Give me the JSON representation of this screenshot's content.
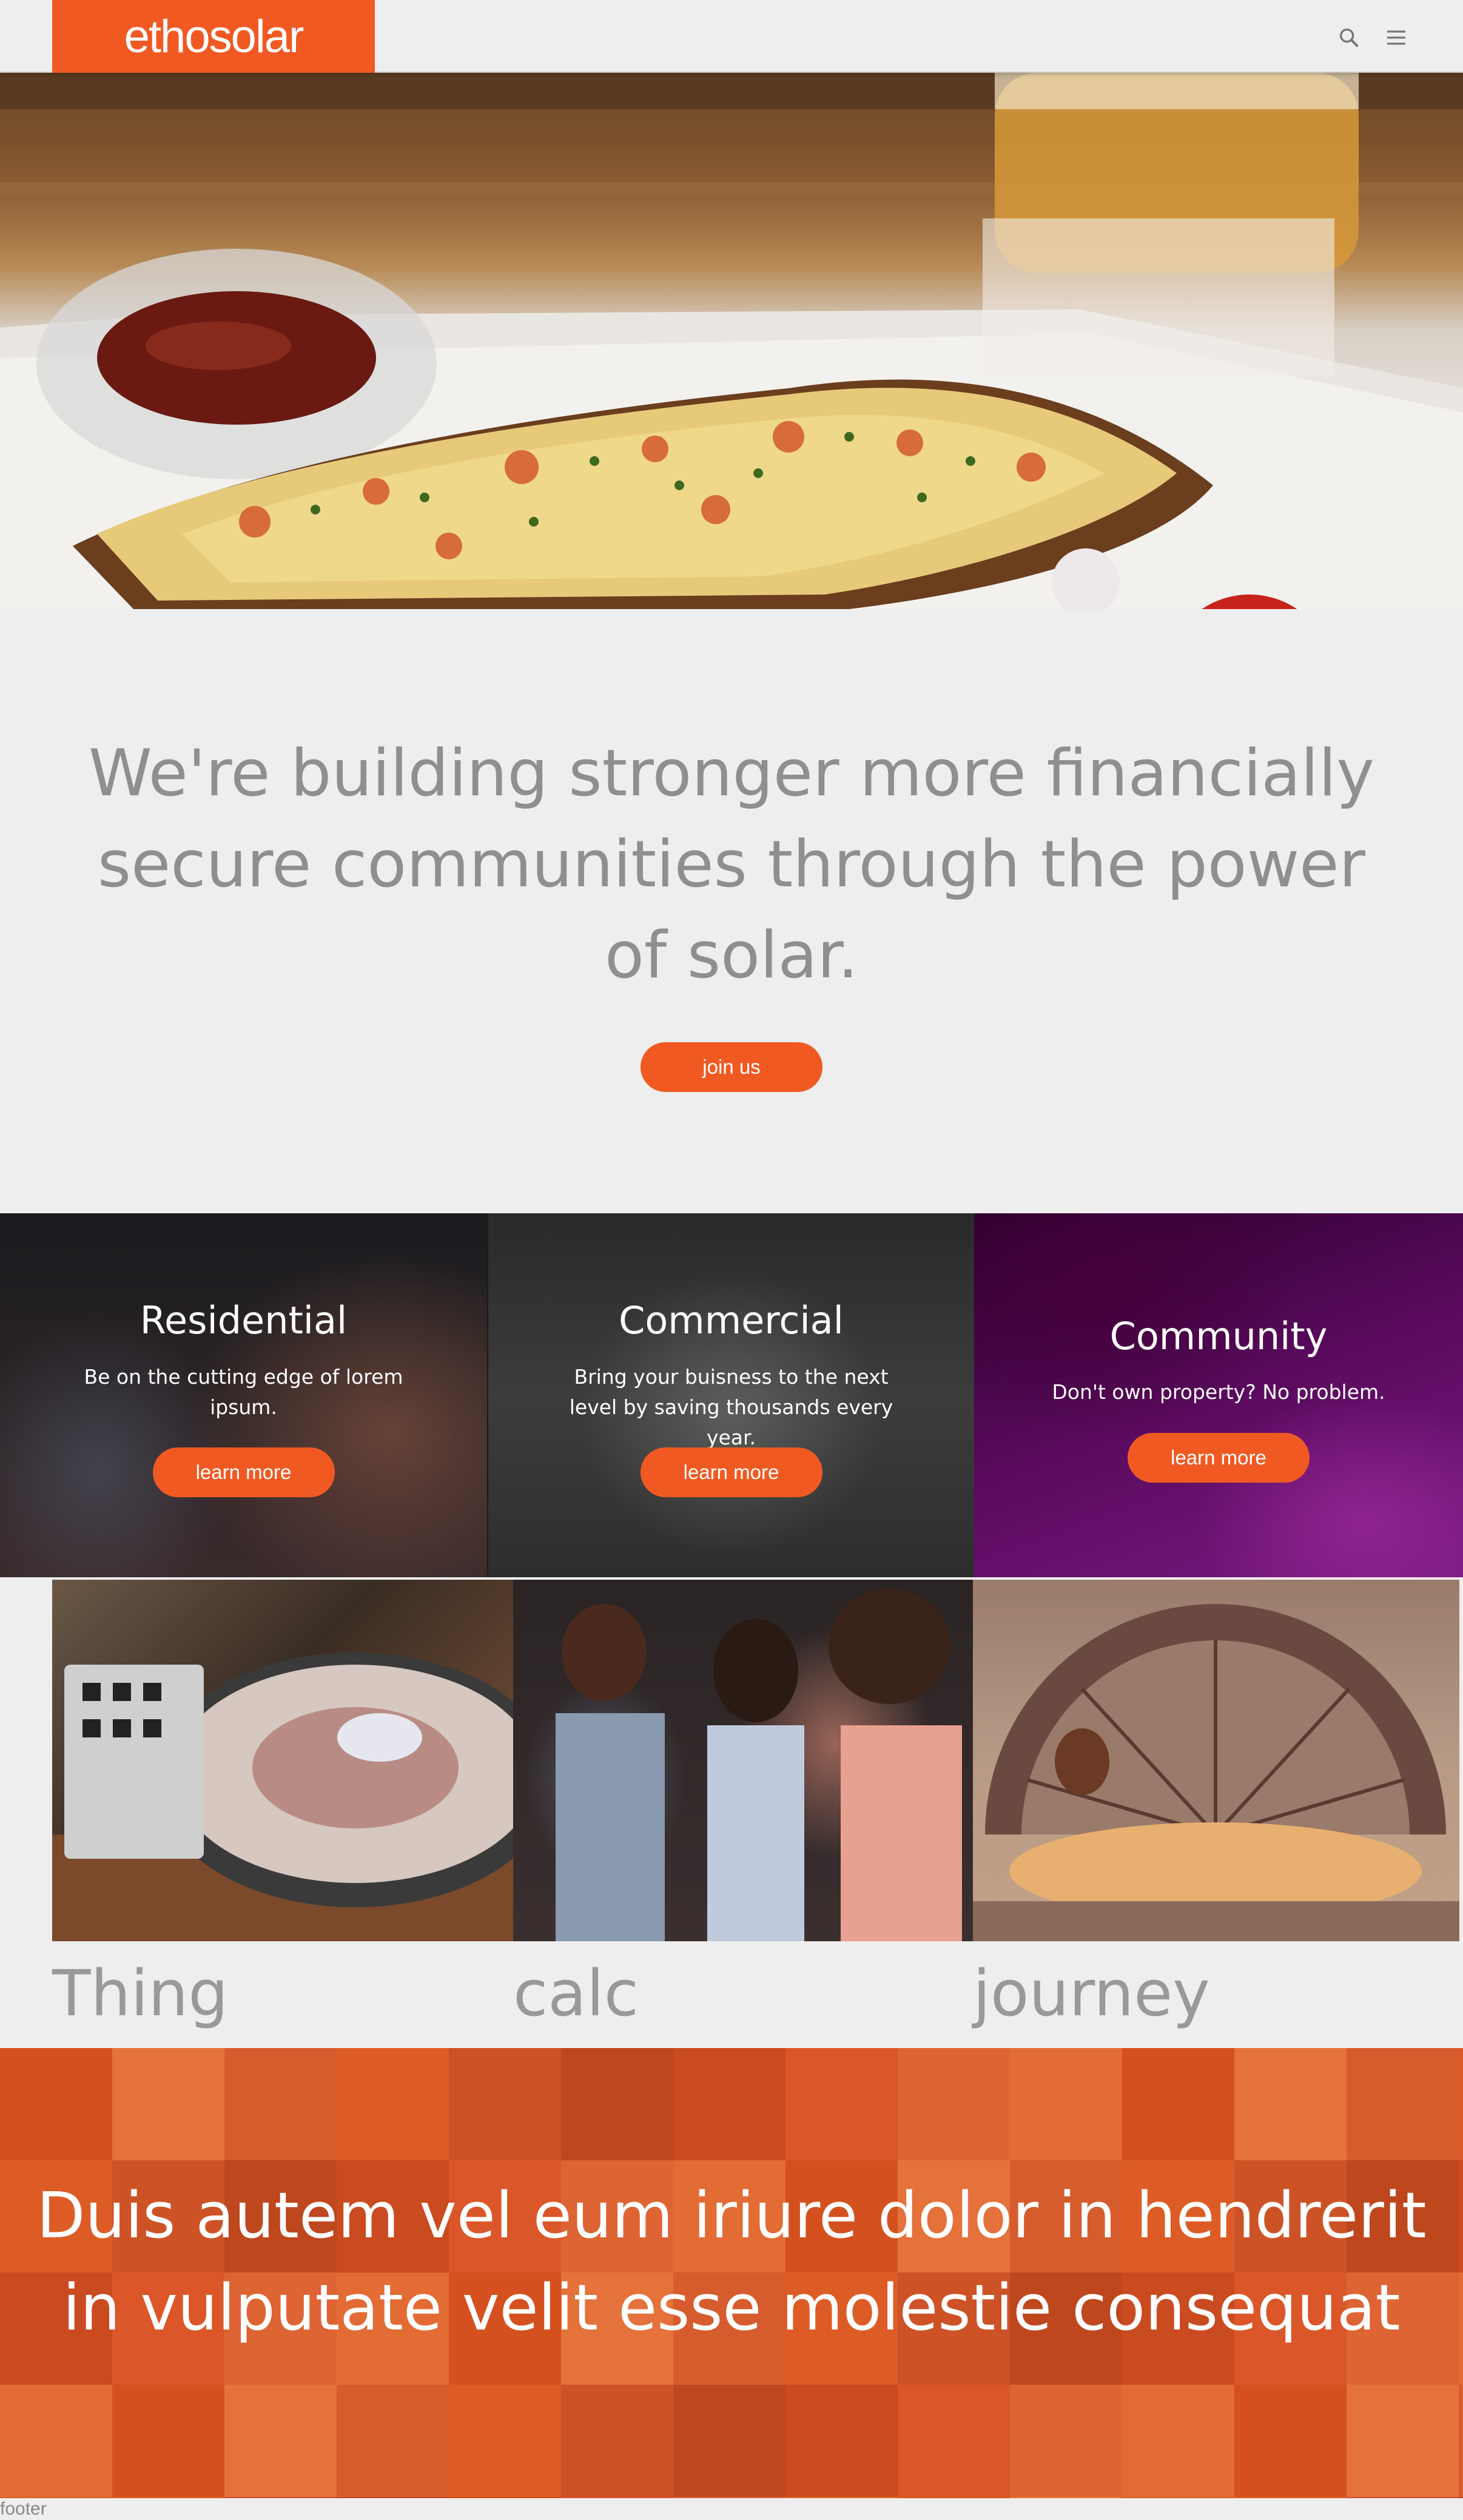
{
  "header": {
    "logo_text": "ethosolar",
    "brand_color": "#f05a22",
    "icons": [
      "search-icon",
      "menu-icon"
    ]
  },
  "hero": {
    "image": "hero-food-photo"
  },
  "mission": {
    "text": "We're building stronger more financially secure communities through the power of solar.",
    "button_label": "join us"
  },
  "panels": [
    {
      "title": "Residential",
      "description": "Be on the cutting edge of lorem ipsum.",
      "button_label": "learn more"
    },
    {
      "title": "Commercial",
      "description": "Bring your buisness to the next level by saving thousands every year.",
      "button_label": "learn more"
    },
    {
      "title": "Community",
      "description": "Don't own property? No problem.",
      "button_label": "learn more"
    }
  ],
  "gallery": {
    "labels": [
      "Thing",
      "calc",
      "journey"
    ]
  },
  "banner": {
    "text": "Duis autem vel eum iriure dolor in hendrerit in vulputate velit esse molestie consequat"
  },
  "footer": {
    "text": "footer"
  }
}
